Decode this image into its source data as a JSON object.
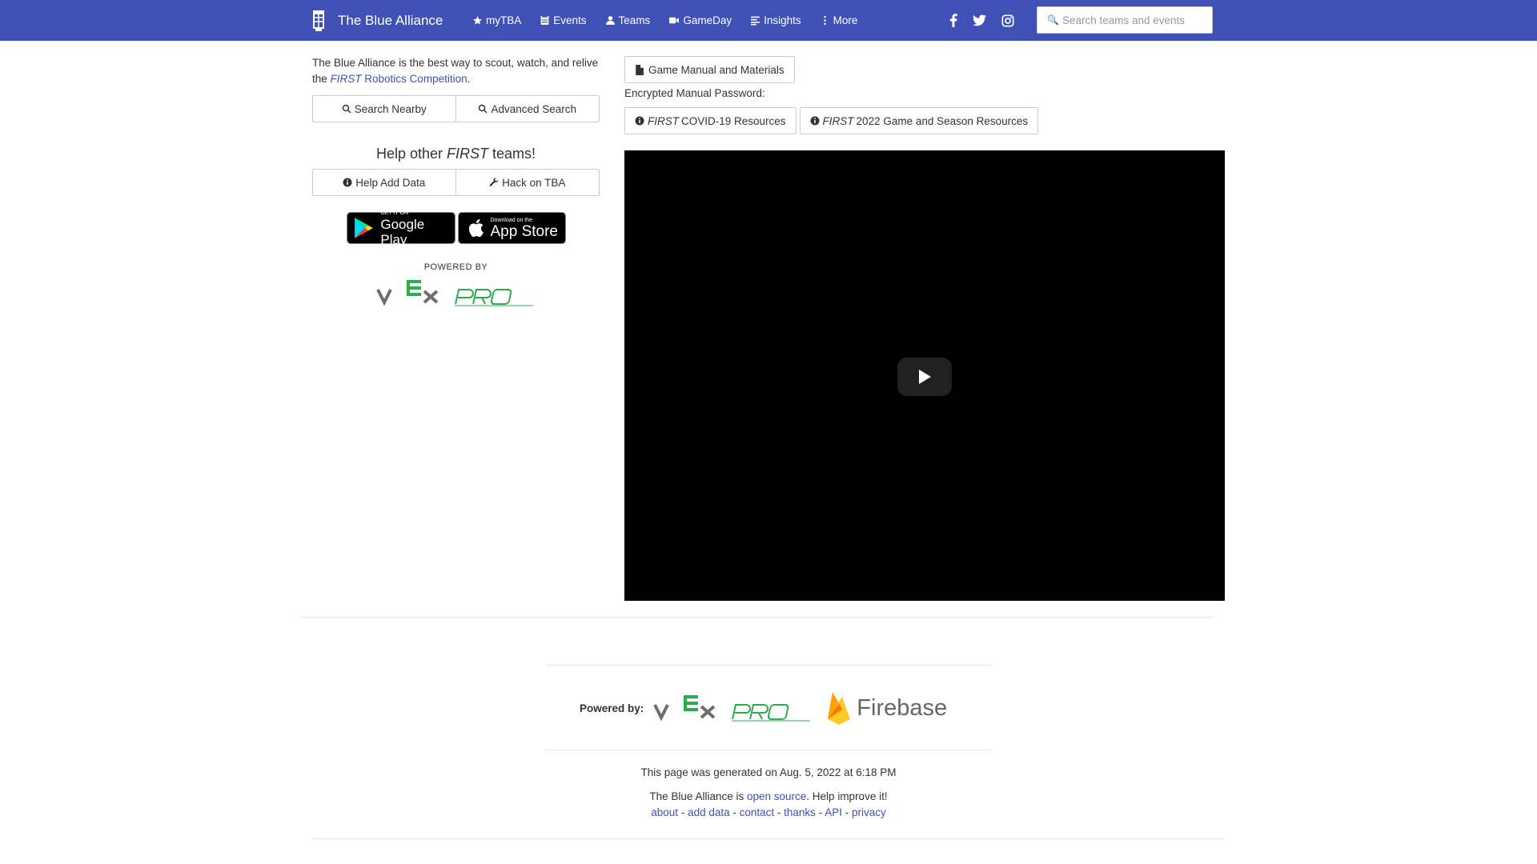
{
  "colors": {
    "navbar": "#3f51b5",
    "link": "#3f51b5"
  },
  "nav": {
    "brand": "The Blue Alliance",
    "links": [
      {
        "label": "myTBA",
        "icon": "star-icon"
      },
      {
        "label": "Events",
        "icon": "calendar-icon"
      },
      {
        "label": "Teams",
        "icon": "user-icon"
      },
      {
        "label": "GameDay",
        "icon": "video-camera-icon"
      },
      {
        "label": "Insights",
        "icon": "list-icon"
      },
      {
        "label": "More",
        "icon": "more-vertical-icon"
      }
    ],
    "social": [
      "facebook-icon",
      "twitter-icon",
      "instagram-icon"
    ],
    "search_placeholder": "Search teams and events"
  },
  "left": {
    "intro_pre": "The Blue Alliance is the best way to scout, watch, and relive the ",
    "intro_link_italic": "FIRST",
    "intro_link_rest": " Robotics Competition",
    "intro_post": ".",
    "search_nearby": "Search Nearby",
    "advanced_search": "Advanced Search",
    "help_pre": "Help other ",
    "help_italic": "FIRST",
    "help_post": " teams!",
    "help_add_data": "Help Add Data",
    "hack_on_tba": "Hack on TBA",
    "google_play_small": "GET IT ON",
    "google_play_big": "Google Play",
    "app_store_small": "Download on the",
    "app_store_big": "App Store",
    "powered_by": "POWERED BY",
    "vex_logo_text": "VEX PRO"
  },
  "right": {
    "game_manual": "Game Manual and Materials",
    "password_label": "Encrypted Manual Password:",
    "covid_italic": "FIRST",
    "covid_rest": "COVID-19 Resources",
    "season_italic": "FIRST",
    "season_rest": "2022 Game and Season Resources"
  },
  "footer": {
    "powered_label": "Powered by:",
    "vex_logo_text": "VEX PRO",
    "firebase": "Firebase",
    "generated": "This page was generated on Aug. 5, 2022 at 6:18 PM",
    "os_pre": "The Blue Alliance is ",
    "os_link": "open source",
    "os_post": ". Help improve it!",
    "links": [
      "about",
      "add data",
      "contact",
      "thanks",
      "API",
      "privacy"
    ],
    "separator": " - "
  }
}
